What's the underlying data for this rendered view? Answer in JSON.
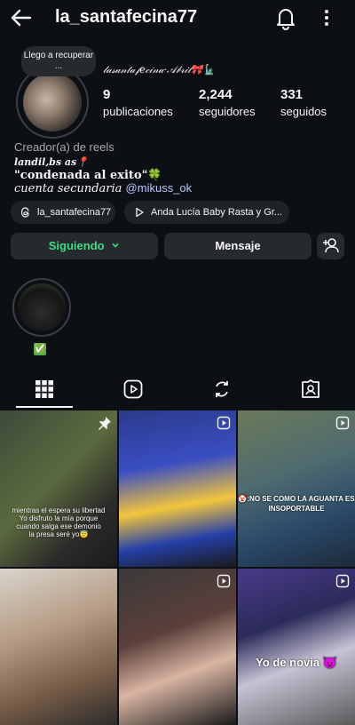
{
  "header": {
    "username": "la_santafecina77"
  },
  "story_bubble": {
    "text": "Llego a recuperar ..."
  },
  "profile": {
    "display_name": "𝓁𝒶𝓈𝒶𝓃𝓉𝒶𝒻𝑒𝒸𝒾𝓃𝒶·𝒜𝒷𝓇𝒾𝓁🎀🗽",
    "category": "Creador(a) de reels",
    "bio_line1": "𝒍𝒂𝒏𝒅𝒊𝒍,𝒃𝒔 𝒂𝒔📍",
    "bio_line2": "\"condenada al exito\"🍀",
    "bio_line3_text": "cuenta secundaria ",
    "bio_line3_mention": "@mikuss_ok"
  },
  "stats": [
    {
      "value": "9",
      "label": "publicaciones"
    },
    {
      "value": "2,244",
      "label": "seguidores"
    },
    {
      "value": "331",
      "label": "seguidos"
    }
  ],
  "chips": {
    "threads": "la_santafecina77",
    "music": "Anda Lucía Baby Rasta y Gr..."
  },
  "buttons": {
    "following": "Siguiendo",
    "message": "Mensaje"
  },
  "highlight": {
    "label": "✅"
  },
  "posts": [
    {
      "caption": "mientras el espera su libertad\nYo disfruto la mía porque\ncuando salga ese demonio\nla presa seré yo😇",
      "badge": "pin-icon"
    },
    {
      "caption": "",
      "badge": "reel-icon"
    },
    {
      "caption": "🤡:NO SE COMO LA AGUANTA ES\nINSOPORTABLE",
      "badge": "reel-icon"
    },
    {
      "caption": "",
      "badge": ""
    },
    {
      "caption": "",
      "badge": "reel-icon"
    },
    {
      "caption": "Yo de novia 😈",
      "badge": "reel-icon"
    }
  ],
  "colors": {
    "background": "#0c1014",
    "following_text": "#3ddc84",
    "mention": "#b7c8ff"
  }
}
